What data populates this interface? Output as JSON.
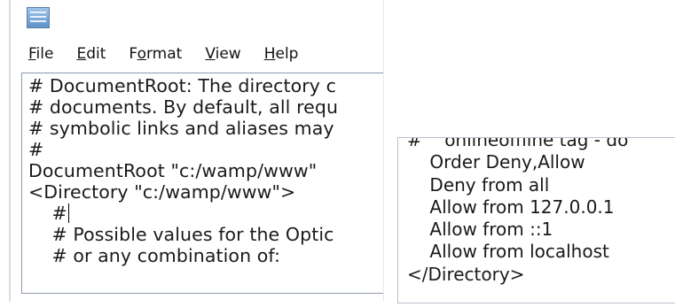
{
  "left_window": {
    "menu": [
      "File",
      "Edit",
      "Format",
      "View",
      "Help"
    ],
    "menu_mnemonics": [
      "F",
      "E",
      "o",
      "V",
      "H"
    ],
    "lines": [
      "# DocumentRoot: The directory c",
      "# documents. By default, all requ",
      "# symbolic links and aliases may",
      "#",
      "DocumentRoot \"c:/wamp/www\"",
      "<Directory \"c:/wamp/www\">",
      "    #",
      "    # Possible values for the Optic",
      "    # or any combination of:"
    ]
  },
  "right_window": {
    "lines": [
      "#    onlineoffline tag - do",
      "    Order Deny,Allow",
      "    Deny from all",
      "    Allow from 127.0.0.1",
      "    Allow from ::1",
      "    Allow from localhost",
      "</Directory>"
    ]
  }
}
